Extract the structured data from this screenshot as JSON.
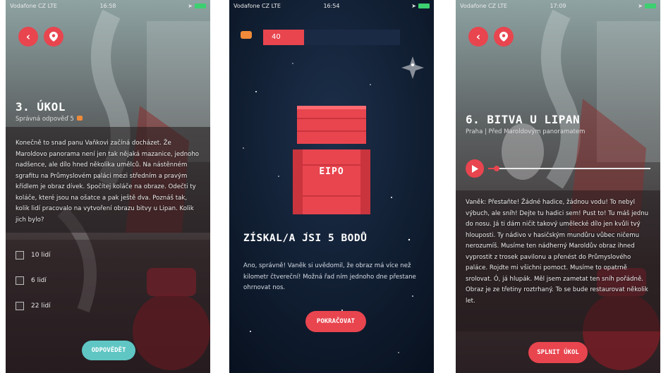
{
  "screen1": {
    "status": {
      "carrier": "Vodafone CZ  LTE",
      "time": "16:58"
    },
    "title": "3. ÚKOL",
    "subtitle": "Správná odpověď 5",
    "body": "Konečně to snad panu Vaňkovi začíná docházet. Že Maroldovo panorama není jen tak nějaká mazanice, jednoho nadšence, ale dílo hned několika umělců. Na nástěnném sgrafitu na Průmyslovém paláci mezi středním a pravým křídlem je obraz dívek. Spočítej koláče na obraze. Odečti ty koláče, které jsou na ošatce a pak ještě dva. Poznáš tak, kolik lidí pracovalo na vytvoření obrazu bitvy u Lipan. Kolik jich bylo?",
    "options": [
      "10 lidí",
      "6 lidí",
      "22 lidí"
    ],
    "answer_button": "ODPOVĚDĚT"
  },
  "screen2": {
    "status": {
      "carrier": "Vodafone CZ  LTE",
      "time": "16:54"
    },
    "score": "40",
    "score_fraction": 0.3,
    "chest_label": "EIPO",
    "heading": "ZÍSKAL/A JSI 5 BODŮ",
    "body": "Ano, správně! Vaněk si uvědomil, že obraz má více než kilometr čtvereční! Možná řad ním jednoho dne přestane ohrnovat nos.",
    "continue_button": "POKRAČOVAT"
  },
  "screen3": {
    "status": {
      "carrier": "Vodafone CZ  LTE",
      "time": "17:09"
    },
    "title": "6. BITVA U LIPAN",
    "subtitle": "Praha | Před Maroldovým panoramatem",
    "audio_progress": 0.05,
    "body": "Vaněk: Přestaňte! Žádné hadice, žádnou vodu! To nebyl výbuch, ale sníh! Dejte tu hadici sem! Pust to! Tu máš jednu do nosu. Já ti dám ničit takový umělecké dílo jen kvůli tvý hlouposti. Ty nádivo v hasičským mundůru vůbec ničemu nerozumíš. Musíme ten nádherný Maroldův obraz ihned vyprostit z trosek pavilonu a přenést do Průmyslového paláce. Rojdte mi všichni pomoct. Musíme to opatrně srolovat. Ó, já hlupák. Měl jsem zametat ten sníh pořádně. Obraz je ze třetiny roztrhaný. To se bude restaurovat několik let.",
    "complete_button": "SPLNIT ÚKOL"
  },
  "colors": {
    "accent": "#e8454f",
    "teal": "#5fc6c4",
    "dark_navy": "#0c1728"
  },
  "icons": [
    "back-arrow-icon",
    "location-pin-icon",
    "play-icon",
    "coin-icon",
    "signal-icon",
    "battery-icon"
  ]
}
